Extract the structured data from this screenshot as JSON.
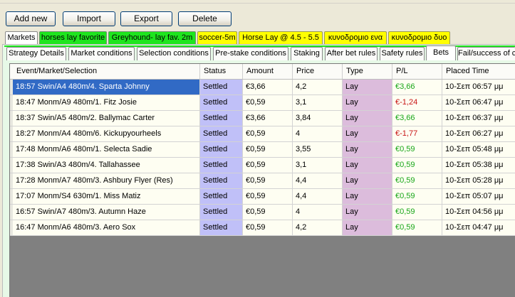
{
  "toolbar": {
    "add_new": "Add new",
    "import": "Import",
    "export": "Export",
    "delete": "Delete"
  },
  "strategy_tabs": [
    {
      "label": "Markets",
      "color": "#ffffff"
    },
    {
      "label": "horses lay favorite",
      "color": "#1ee51e"
    },
    {
      "label": "Greyhound- lay fav. 2m",
      "color": "#1ee51e"
    },
    {
      "label": "soccer-5m",
      "color": "#ffff00"
    },
    {
      "label": "Horse Lay  @ 4.5 - 5.5",
      "color": "#ffff00"
    },
    {
      "label": "κυνοδρομιο ενα",
      "color": "#ffff00"
    },
    {
      "label": "κυνοδρομιο δυο",
      "color": "#ffff00"
    }
  ],
  "section_tabs": [
    {
      "label": "Strategy Details"
    },
    {
      "label": "Market conditions"
    },
    {
      "label": "Selection conditions"
    },
    {
      "label": "Pre-stake conditions"
    },
    {
      "label": "Staking"
    },
    {
      "label": "After bet rules"
    },
    {
      "label": "Safety rules"
    },
    {
      "label": "Bets"
    },
    {
      "label": "Fail/success of c"
    }
  ],
  "active_section_tab": "Bets",
  "table": {
    "columns": [
      "Event/Market/Selection",
      "Status",
      "Amount",
      "Price",
      "Type",
      "P/L",
      "Placed Time"
    ],
    "colors": {
      "status_bg": "#c0c0f8",
      "type_bg": "#dcbcdc",
      "selected_bg": "#316ac5",
      "row_bg": "#fefef2",
      "pl_positive": "#17a617",
      "pl_negative": "#c81414"
    },
    "rows": [
      {
        "event": "18:57 Swin/A4 480m/4. Sparta Johnny",
        "status": "Settled",
        "amount": "€3,66",
        "price": "4,2",
        "type": "Lay",
        "pl": "€3,66",
        "pl_sign": "positive",
        "placed": "10-Σεπ 06:57 μμ",
        "selected": true
      },
      {
        "event": "18:47 Monm/A9 480m/1. Fitz Josie",
        "status": "Settled",
        "amount": "€0,59",
        "price": "3,1",
        "type": "Lay",
        "pl": "€-1,24",
        "pl_sign": "negative",
        "placed": "10-Σεπ 06:47 μμ",
        "selected": false
      },
      {
        "event": "18:37 Swin/A5 480m/2. Ballymac Carter",
        "status": "Settled",
        "amount": "€3,66",
        "price": "3,84",
        "type": "Lay",
        "pl": "€3,66",
        "pl_sign": "positive",
        "placed": "10-Σεπ 06:37 μμ",
        "selected": false
      },
      {
        "event": "18:27 Monm/A4 480m/6. Kickupyourheels",
        "status": "Settled",
        "amount": "€0,59",
        "price": "4",
        "type": "Lay",
        "pl": "€-1,77",
        "pl_sign": "negative",
        "placed": "10-Σεπ 06:27 μμ",
        "selected": false
      },
      {
        "event": "17:48 Monm/A6 480m/1. Selecta Sadie",
        "status": "Settled",
        "amount": "€0,59",
        "price": "3,55",
        "type": "Lay",
        "pl": "€0,59",
        "pl_sign": "positive",
        "placed": "10-Σεπ 05:48 μμ",
        "selected": false
      },
      {
        "event": "17:38 Swin/A3 480m/4. Tallahassee",
        "status": "Settled",
        "amount": "€0,59",
        "price": "3,1",
        "type": "Lay",
        "pl": "€0,59",
        "pl_sign": "positive",
        "placed": "10-Σεπ 05:38 μμ",
        "selected": false
      },
      {
        "event": "17:28 Monm/A7 480m/3. Ashbury Flyer (Res)",
        "status": "Settled",
        "amount": "€0,59",
        "price": "4,4",
        "type": "Lay",
        "pl": "€0,59",
        "pl_sign": "positive",
        "placed": "10-Σεπ 05:28 μμ",
        "selected": false
      },
      {
        "event": "17:07 Monm/S4 630m/1. Miss Matiz",
        "status": "Settled",
        "amount": "€0,59",
        "price": "4,4",
        "type": "Lay",
        "pl": "€0,59",
        "pl_sign": "positive",
        "placed": "10-Σεπ 05:07 μμ",
        "selected": false
      },
      {
        "event": "16:57 Swin/A7 480m/3. Autumn Haze",
        "status": "Settled",
        "amount": "€0,59",
        "price": "4",
        "type": "Lay",
        "pl": "€0,59",
        "pl_sign": "positive",
        "placed": "10-Σεπ 04:56 μμ",
        "selected": false
      },
      {
        "event": "16:47 Monm/A6 480m/3. Aero Sox",
        "status": "Settled",
        "amount": "€0,59",
        "price": "4,2",
        "type": "Lay",
        "pl": "€0,59",
        "pl_sign": "positive",
        "placed": "10-Σεπ 04:47 μμ",
        "selected": false
      }
    ]
  }
}
